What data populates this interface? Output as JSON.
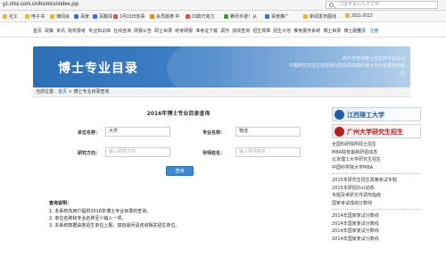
{
  "browser": {
    "url": "yz.chsi.com.cn/bsmlcx/index.jsp",
    "search_placeholder": "习近平关心人才工作"
  },
  "bookmarks": [
    {
      "label": "社工",
      "color": "#e6b84a"
    },
    {
      "label": "电子书",
      "color": "#e6b84a"
    },
    {
      "label": "博闻会",
      "color": "#e6b84a"
    },
    {
      "label": "百度",
      "color": "#3b6fd8"
    },
    {
      "label": "百翻译",
      "color": "#3b6fd8"
    },
    {
      "label": "1月23日债事",
      "color": "#d9534f"
    },
    {
      "label": "会员版表 中",
      "color": "#e08a2b"
    },
    {
      "label": "15款巧克力",
      "color": "#d9534f"
    },
    {
      "label": "腾讯手游！从",
      "color": "#3a9e3a"
    },
    {
      "label": "百度推广",
      "color": "#3b6fd8"
    },
    {
      "label": "新闻发布图线",
      "color": "#e6b84a"
    },
    {
      "label": "2011-2013",
      "color": "#e6b84a"
    }
  ],
  "topnav": {
    "links": [
      "首页",
      "政策",
      "资讯",
      "院校报考",
      "专业知识库",
      "在线咨询",
      "网报公告",
      "硕士目录",
      "统考网报",
      "准考证下载",
      "调剂",
      "成绩查询",
      "招生简章",
      "招生计划",
      "推免服务系统",
      "博士目录",
      "博士服务"
    ],
    "login": "登录",
    "register": "注册"
  },
  "banner": {
    "title": "博士专业目录",
    "tagline": [
      "用户可查询博士招生的专业情况",
      "中国研究生招生信息网为您提供权威的博士专业目录查询服务"
    ]
  },
  "breadcrumb": {
    "prefix": "当前位置：",
    "home": "首页",
    "sep": " > ",
    "current": "博士专业目录查询"
  },
  "form": {
    "title": "2016年博士专业目录查询",
    "unit_label": "单位名称：",
    "unit_value": "大学",
    "major_label": "专业名称：",
    "major_value": "物流",
    "direction_label": "研究方向：",
    "direction_placeholder": "输入研究方向",
    "supervisor_label": "导师姓名：",
    "supervisor_placeholder": "输入导师姓名",
    "submit": "查询"
  },
  "notice": {
    "head": "查询说明：",
    "items": [
      "1. 本系统向用户提供2016年博士专业目录的查询。",
      "2. 单位名称和专业名称至少输入一项。",
      "3. 本系统数据由各招生单位上报，如有疑问请咨询相关招生单位。"
    ]
  },
  "sidebar": {
    "banner1": "江西理工大学",
    "banner2": "广州大学研究生招生",
    "group1": [
      "全国科研院所硕士招生",
      "MBA院校最新研招动态",
      "北京理工大学研究生招生",
      "中国科学院大学MBA"
    ],
    "group2": [
      "2015年研究生招生政策考试专题",
      "2015年研招办公动态",
      "专题及考研文件调剂指南",
      "国家考试成绩分数线"
    ],
    "group3": [
      "2014年国家复试分数线",
      "2014年国家复试分数线",
      "2014年国家复试分数线",
      "2014年国家复试分数线"
    ]
  }
}
